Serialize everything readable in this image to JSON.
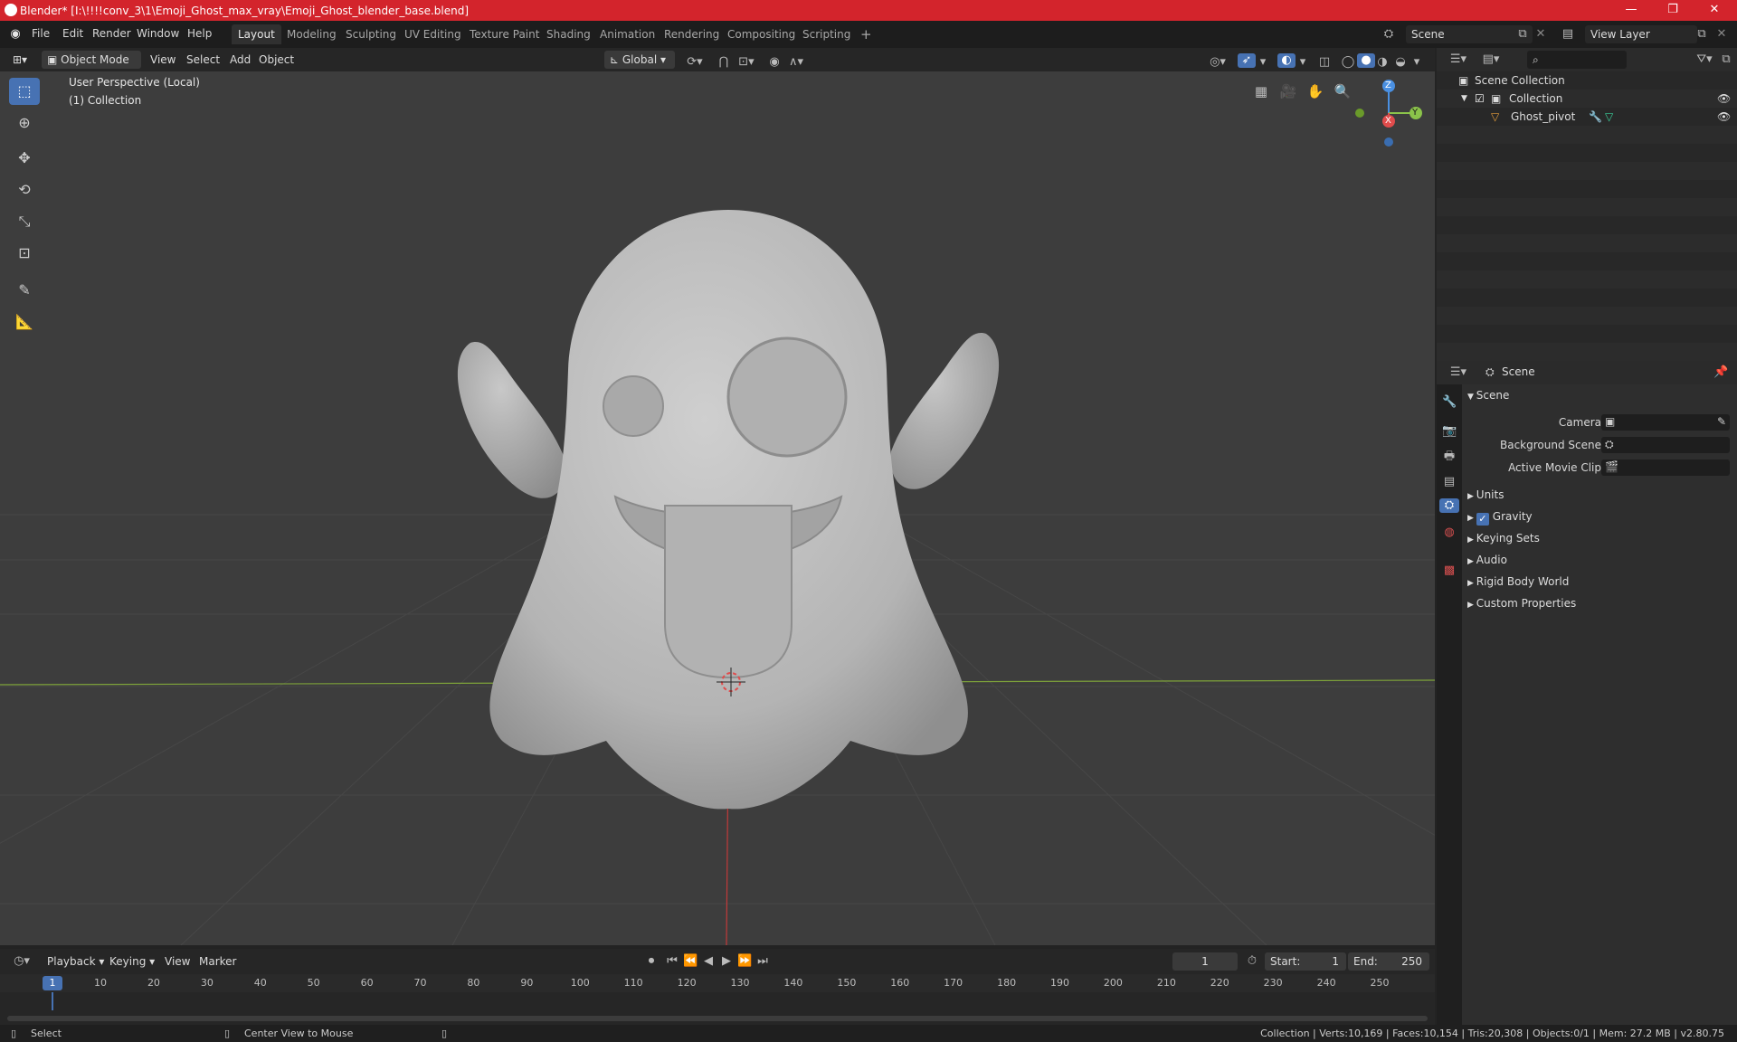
{
  "window": {
    "title": "Blender* [I:\\!!!!conv_3\\1\\Emoji_Ghost_max_vray\\Emoji_Ghost_blender_base.blend]",
    "minimize": "—",
    "maximize": "❐",
    "close": "✕"
  },
  "menubar": {
    "items": [
      "File",
      "Edit",
      "Render",
      "Window",
      "Help"
    ],
    "workspaces": [
      "Layout",
      "Modeling",
      "Sculpting",
      "UV Editing",
      "Texture Paint",
      "Shading",
      "Animation",
      "Rendering",
      "Compositing",
      "Scripting"
    ],
    "active_workspace": "Layout",
    "add_workspace": "+",
    "scene": "Scene",
    "view_layer": "View Layer"
  },
  "viewport_header": {
    "mode": "Object Mode",
    "menus": [
      "View",
      "Select",
      "Add",
      "Object"
    ],
    "transform_orientation": "Global"
  },
  "viewport": {
    "overlay_line1": "User Perspective (Local)",
    "overlay_line2": "(1) Collection",
    "gizmo_axes": {
      "x": "X",
      "y": "Y",
      "z": "Z"
    }
  },
  "outliner": {
    "search_placeholder": "",
    "items": [
      {
        "label": "Scene Collection",
        "depth": 0
      },
      {
        "label": "Collection",
        "depth": 1
      },
      {
        "label": "Ghost_pivot",
        "depth": 2
      }
    ]
  },
  "properties": {
    "header": "Scene",
    "section": "Scene",
    "fields": [
      {
        "label": "Camera",
        "value": ""
      },
      {
        "label": "Background Scene",
        "value": ""
      },
      {
        "label": "Active Movie Clip",
        "value": ""
      }
    ],
    "panels": [
      "Units",
      "Gravity",
      "Keying Sets",
      "Audio",
      "Rigid Body World",
      "Custom Properties"
    ],
    "gravity_checked": true
  },
  "timeline": {
    "menus": [
      "Playback",
      "Keying",
      "View",
      "Marker"
    ],
    "current_frame": "1",
    "start_label": "Start:",
    "start": "1",
    "end_label": "End:",
    "end": "250",
    "ticks": [
      "1",
      "10",
      "20",
      "30",
      "40",
      "50",
      "60",
      "70",
      "80",
      "90",
      "100",
      "110",
      "120",
      "130",
      "140",
      "150",
      "160",
      "170",
      "180",
      "190",
      "200",
      "210",
      "220",
      "230",
      "240",
      "250"
    ]
  },
  "statusbar": {
    "left_action": "Select",
    "middle_action": "Center View to Mouse",
    "stats": "Collection | Verts:10,169 | Faces:10,154 | Tris:20,308 | Objects:0/1 | Mem: 27.2 MB | v2.80.75"
  },
  "colors": {
    "title_bar": "#d3242c",
    "accent": "#4772b3",
    "x_axis": "#e04c4c",
    "y_axis": "#8bc34a",
    "z_axis": "#4a90e2"
  }
}
